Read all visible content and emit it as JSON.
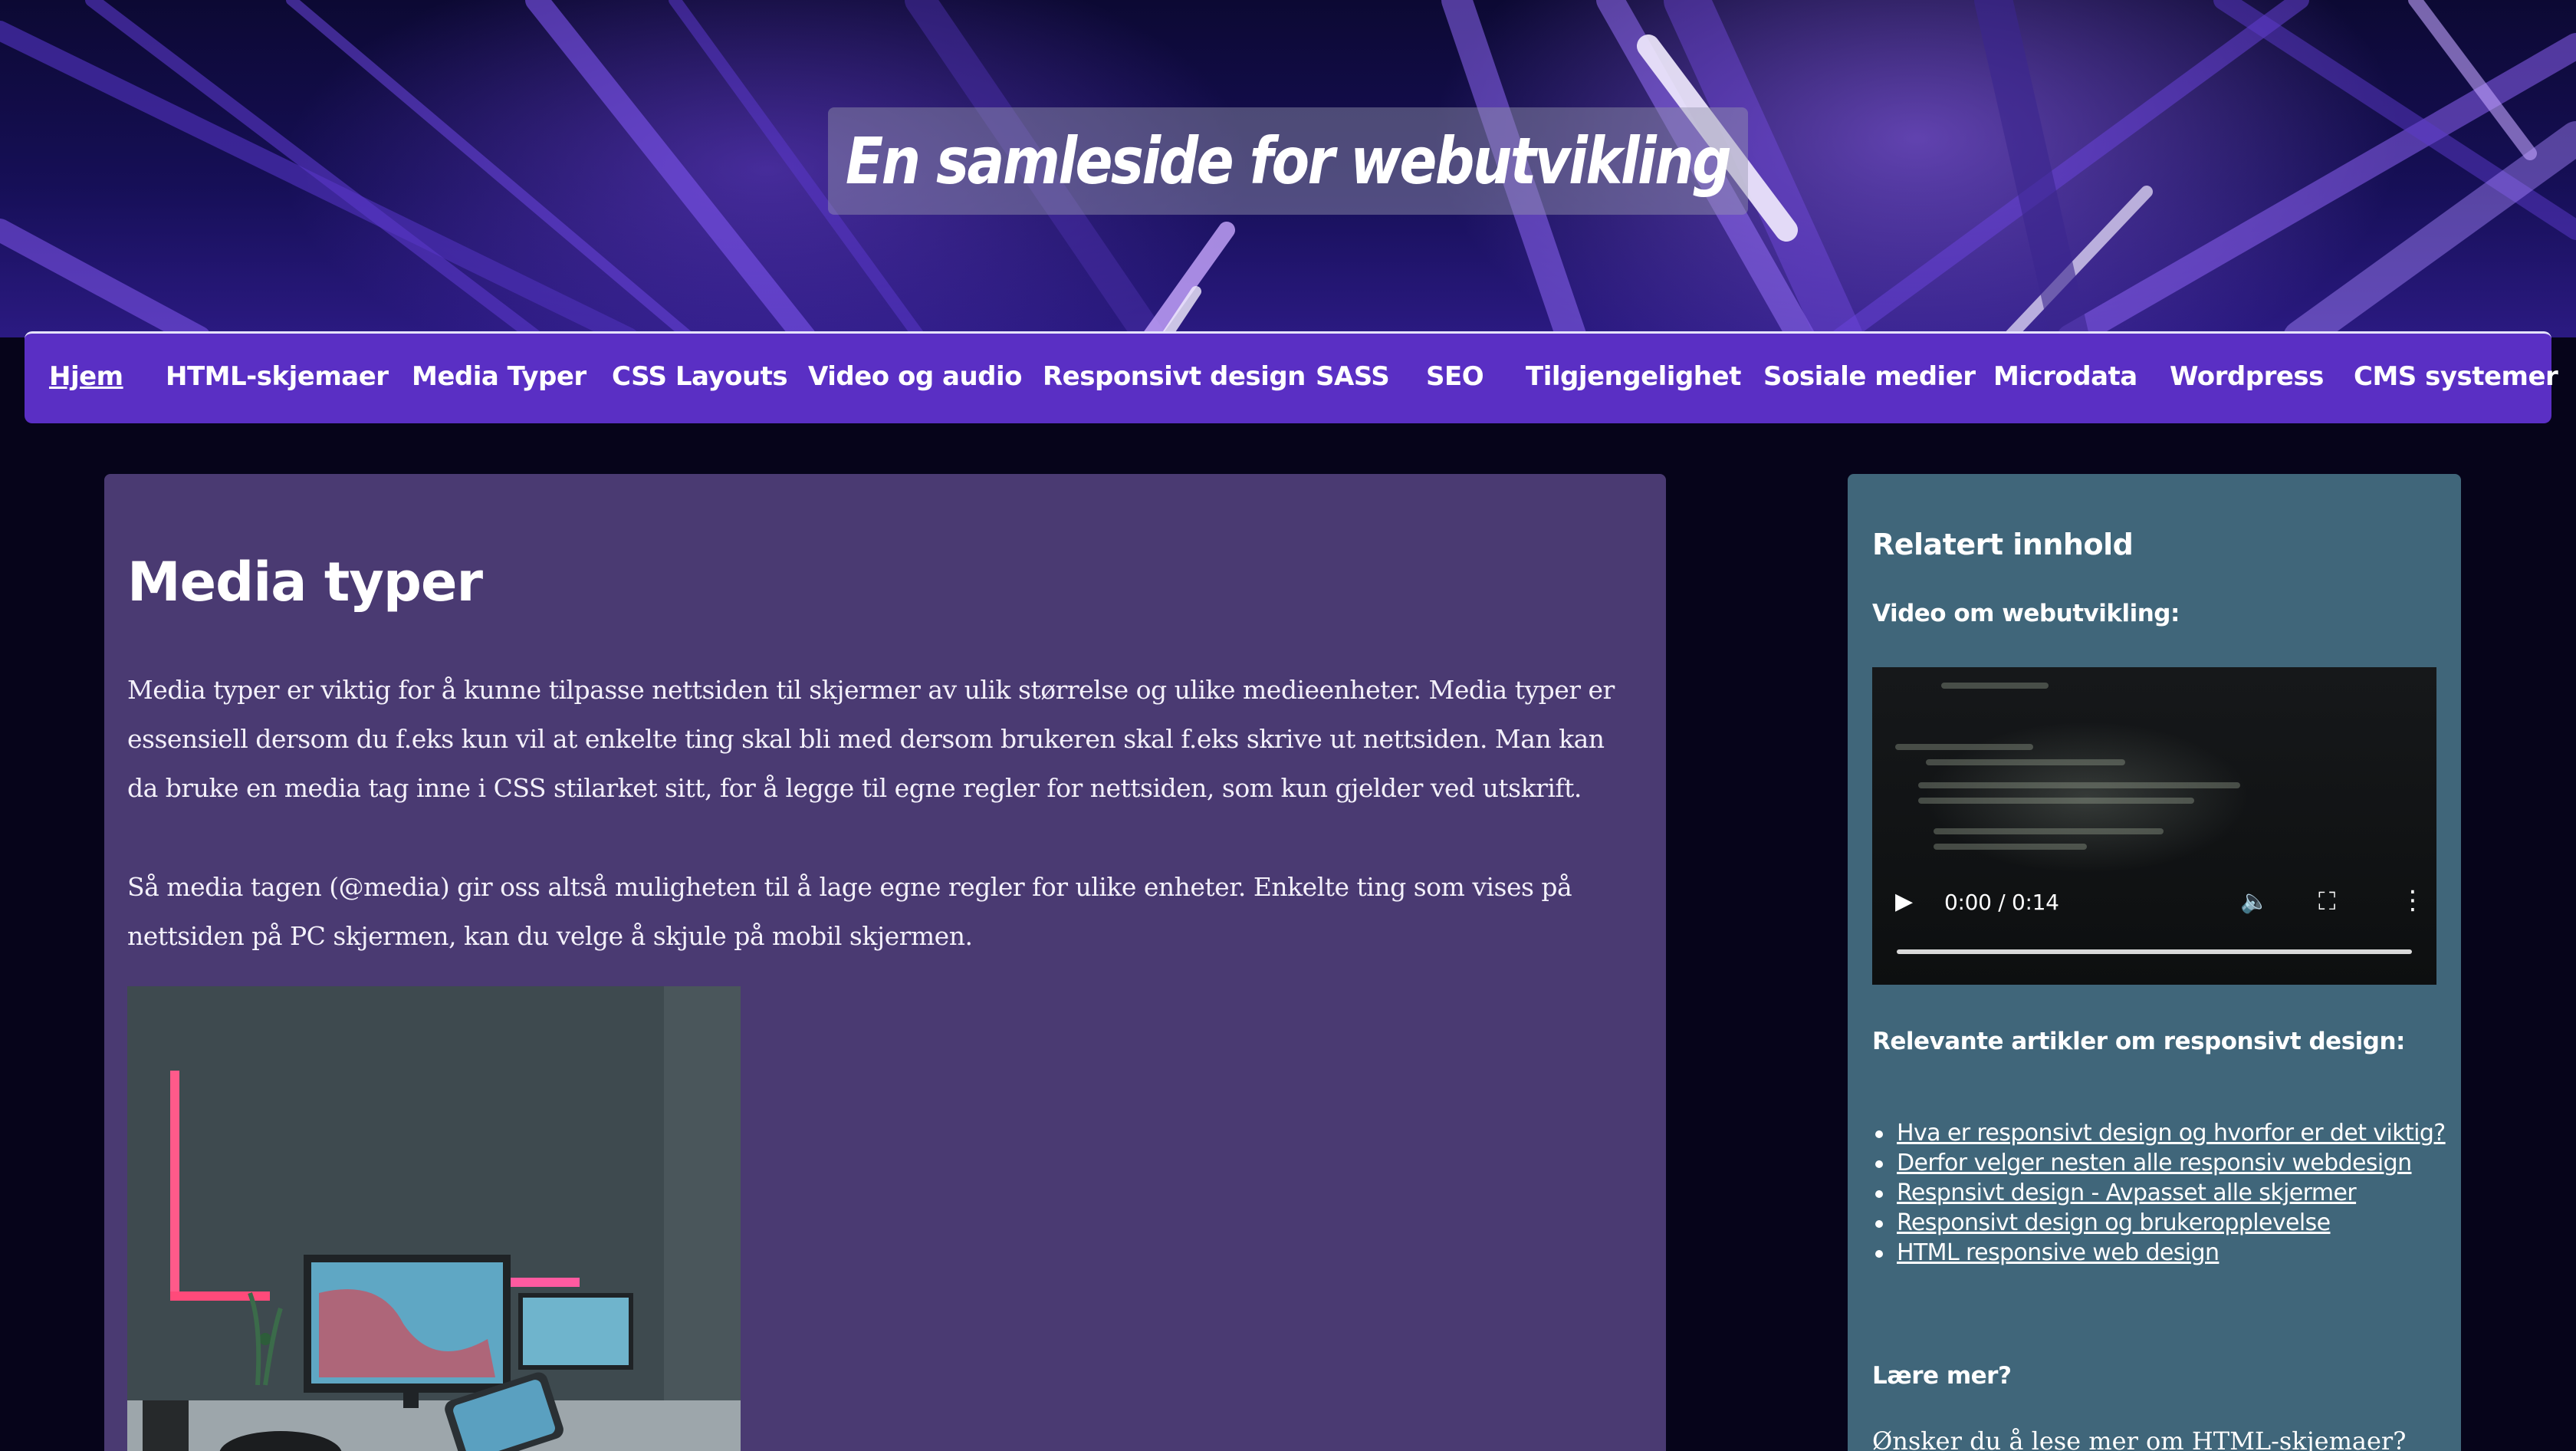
{
  "header": {
    "site_title": "En samleside for webutvikling"
  },
  "nav": {
    "items": [
      {
        "label": "Hjem",
        "active": true
      },
      {
        "label": "HTML-skjemaer"
      },
      {
        "label": "Media Typer"
      },
      {
        "label": "CSS Layouts"
      },
      {
        "label": "Video og audio"
      },
      {
        "label": "Responsivt design"
      },
      {
        "label": "SASS"
      },
      {
        "label": "SEO"
      },
      {
        "label": "Tilgjengelighet"
      },
      {
        "label": "Sosiale medier"
      },
      {
        "label": "Microdata"
      },
      {
        "label": "Wordpress"
      },
      {
        "label": "CMS systemer"
      }
    ]
  },
  "main": {
    "heading": "Media typer",
    "paragraphs": [
      "Media typer er viktig for å kunne tilpasse nettsiden til skjermer av ulik størrelse og ulike medieenheter. Media typer er essensiell dersom du f.eks kun vil at enkelte ting skal bli med dersom brukeren skal f.eks skrive ut nettsiden. Man kan da bruke en media tag inne i CSS stilarket sitt, for å legge til egne regler for nettsiden, som kun gjelder ved utskrift.",
      "Så media tagen (@media) gir oss altså muligheten til å lage egne regler for ulike enheter. Enkelte ting som vises på nettsiden på PC skjermen, kan du velge å skjule på mobil skjermen."
    ]
  },
  "aside": {
    "heading": "Relatert innhold",
    "video_heading": "Video om webutvikling:",
    "video": {
      "time": "0:00 / 0:14",
      "progress": 0
    },
    "links_heading": "Relevante artikler om responsivt design:",
    "links": [
      "Hva er responsivt design og hvorfor er det viktig?",
      "Derfor velger nesten alle responsiv webdesign",
      "Respnsivt design - Avpasset alle skjermer",
      "Responsivt design og brukeropplevelse",
      "HTML responsive web design"
    ],
    "learn_heading": "Lære mer?",
    "learn_text": "Ønsker du å lese mer om HTML-skjemaer?"
  },
  "colors": {
    "nav_bg": "#5a2fc4",
    "main_bg": "#4a3a72",
    "aside_bg": "#40667a",
    "page_bg": "#06041a"
  }
}
